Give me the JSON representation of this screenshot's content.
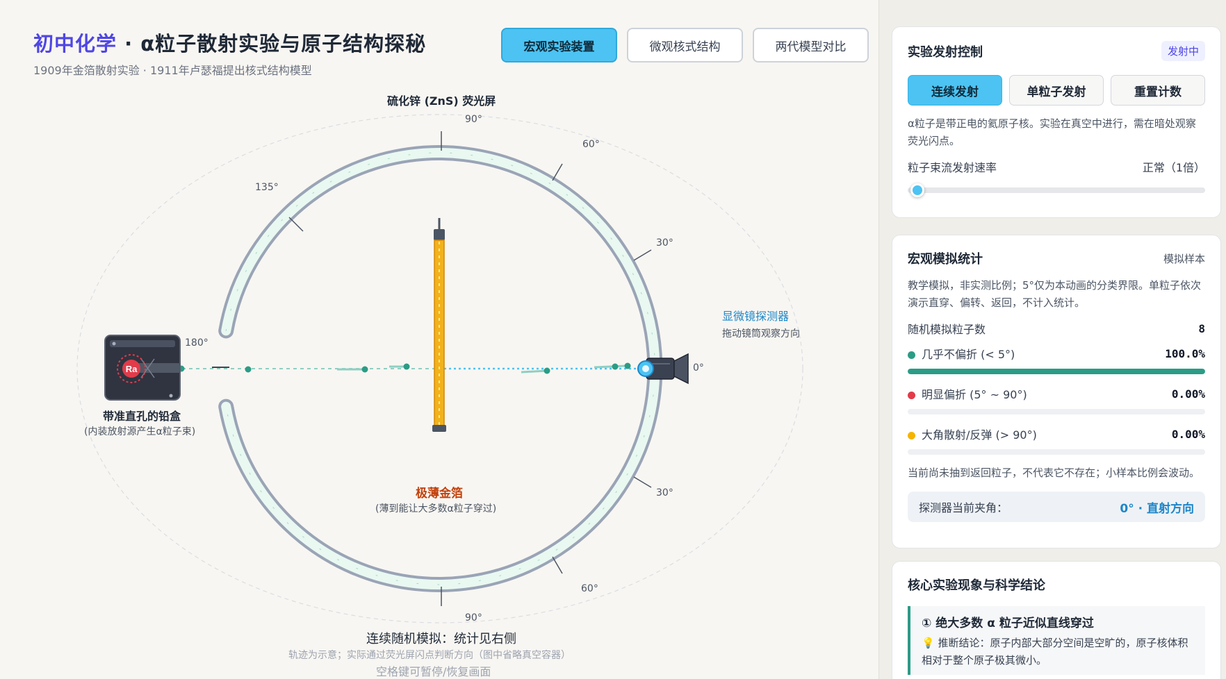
{
  "header": {
    "title_accent": "初中化学",
    "title_rest": " · α粒子散射实验与原子结构探秘",
    "subtitle": "1909年金箔散射实验 · 1911年卢瑟福提出核式结构模型",
    "tabs": [
      {
        "label": "宏观实验装置",
        "active": true
      },
      {
        "label": "微观核式结构",
        "active": false
      },
      {
        "label": "两代模型对比",
        "active": false
      }
    ]
  },
  "stage": {
    "screen_label": "硫化锌 (ZnS) 荧光屏",
    "angle_labels": {
      "top90": "90°",
      "top60": "60°",
      "top30": "30°",
      "top135": "135°",
      "left180": "180°",
      "right0": "0°",
      "bottom30": "30°",
      "bottom60": "60°",
      "bottom90": "90°"
    },
    "source_symbol": "Ra",
    "lead_box_title": "带准直孔的铅盒",
    "lead_box_sub": "(内装放射源产生α粒子束)",
    "foil_title": "极薄金箔",
    "foil_sub": "(薄到能让大多数α粒子穿过)",
    "detector_title": "显微镜探测器",
    "detector_sub": "拖动镜筒观察方向",
    "status": "连续随机模拟：统计见右侧",
    "note": "轨迹为示意；实际通过荧光屏闪点判断方向（图中省略真空容器）",
    "hint": "空格键可暂停/恢复画面"
  },
  "control": {
    "title": "实验发射控制",
    "badge": "发射中",
    "buttons": [
      {
        "label": "连续发射",
        "active": true
      },
      {
        "label": "单粒子发射",
        "active": false
      },
      {
        "label": "重置计数",
        "active": false
      }
    ],
    "description": "α粒子是带正电的氦原子核。实验在真空中进行，需在暗处观察荧光闪点。",
    "rate_label": "粒子束流发射速率",
    "rate_value": "正常（1倍）"
  },
  "stats": {
    "title": "宏观模拟统计",
    "tag": "模拟样本",
    "description": "教学模拟，非实测比例；5°仅为本动画的分类界限。单粒子依次演示直穿、偏转、返回，不计入统计。",
    "count_label": "随机模拟粒子数",
    "count_value": "8",
    "rows": [
      {
        "label": "几乎不偏折 (< 5°)",
        "value": "100.0%",
        "fraction": 1.0,
        "color": "#2b9c86"
      },
      {
        "label": "明显偏折 (5° ~ 90°)",
        "value": "0.00%",
        "fraction": 0.0,
        "color": "#e23b4a"
      },
      {
        "label": "大角散射/反弹 (> 90°)",
        "value": "0.00%",
        "fraction": 0.0,
        "color": "#f5b400"
      }
    ],
    "footnote": "当前尚未抽到返回粒子，不代表它不存在；小样本比例会波动。",
    "detector_angle_label": "探测器当前夹角：",
    "detector_angle_value": "0° · 直射方向"
  },
  "conclusions": {
    "title": "核心实验现象与科学结论",
    "items": [
      {
        "title": "① 绝大多数 α 粒子近似直线穿过",
        "body": "💡 推断结论：原子内部大部分空间是空旷的，原子核体积相对于整个原子极其微小。"
      }
    ]
  },
  "colors": {
    "accent": "#4f46e5",
    "beam": "#4cc3f2",
    "gold": "#f2b21c",
    "particle": "#2b9c86"
  }
}
